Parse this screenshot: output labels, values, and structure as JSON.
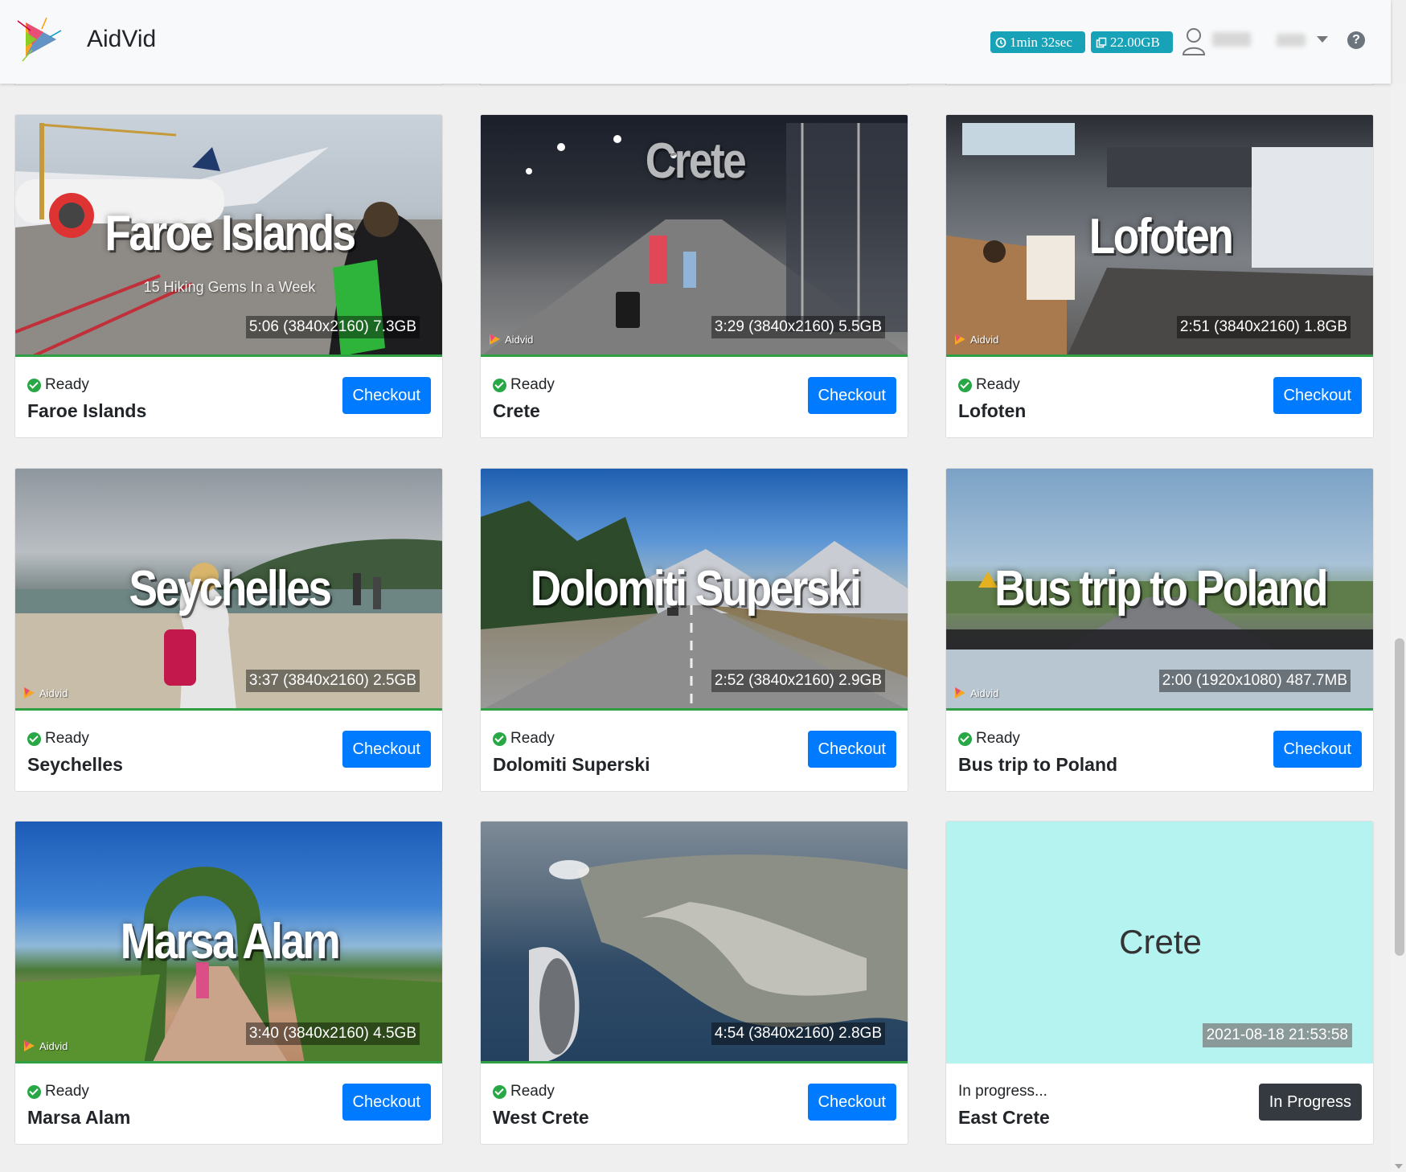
{
  "header": {
    "brand": "AidVid",
    "time_pill": "1min 32sec",
    "storage_pill": "22.00GB",
    "colors": {
      "accent": "#17a2b8",
      "primary": "#007bff",
      "success": "#28a745"
    },
    "icons": [
      "app-logo-icon",
      "clock-icon",
      "copy-icon",
      "user-icon",
      "chevron-down-icon",
      "question-circle-icon"
    ]
  },
  "watermark": "Aidvid",
  "videos": [
    {
      "overlay_title": "Faroe Islands",
      "overlay_subtitle": "15 Hiking Gems In a Week",
      "meta": "5:06 (3840x2160) 7.3GB",
      "status": "Ready",
      "name": "Faroe Islands",
      "button": "Checkout"
    },
    {
      "overlay_title": "Crete",
      "meta": "3:29 (3840x2160) 5.5GB",
      "status": "Ready",
      "name": "Crete",
      "button": "Checkout"
    },
    {
      "overlay_title": "Lofoten",
      "meta": "2:51 (3840x2160) 1.8GB",
      "status": "Ready",
      "name": "Lofoten",
      "button": "Checkout"
    },
    {
      "overlay_title": "Seychelles",
      "meta": "3:37 (3840x2160) 2.5GB",
      "status": "Ready",
      "name": "Seychelles",
      "button": "Checkout"
    },
    {
      "overlay_title": "Dolomiti Superski",
      "meta": "2:52 (3840x2160) 2.9GB",
      "status": "Ready",
      "name": "Dolomiti Superski",
      "button": "Checkout"
    },
    {
      "overlay_title": "Bus trip to Poland",
      "meta": "2:00 (1920x1080) 487.7MB",
      "status": "Ready",
      "name": "Bus trip to Poland",
      "button": "Checkout"
    },
    {
      "overlay_title": "Marsa Alam",
      "meta": "3:40 (3840x2160) 4.5GB",
      "status": "Ready",
      "name": "Marsa Alam",
      "button": "Checkout"
    },
    {
      "meta": "4:54 (3840x2160) 2.8GB",
      "status": "Ready",
      "name": "West Crete",
      "button": "Checkout"
    },
    {
      "placeholder_title": "Crete",
      "meta": "2021-08-18 21:53:58",
      "status": "In progress...",
      "name": "East Crete",
      "button": "In Progress"
    }
  ]
}
